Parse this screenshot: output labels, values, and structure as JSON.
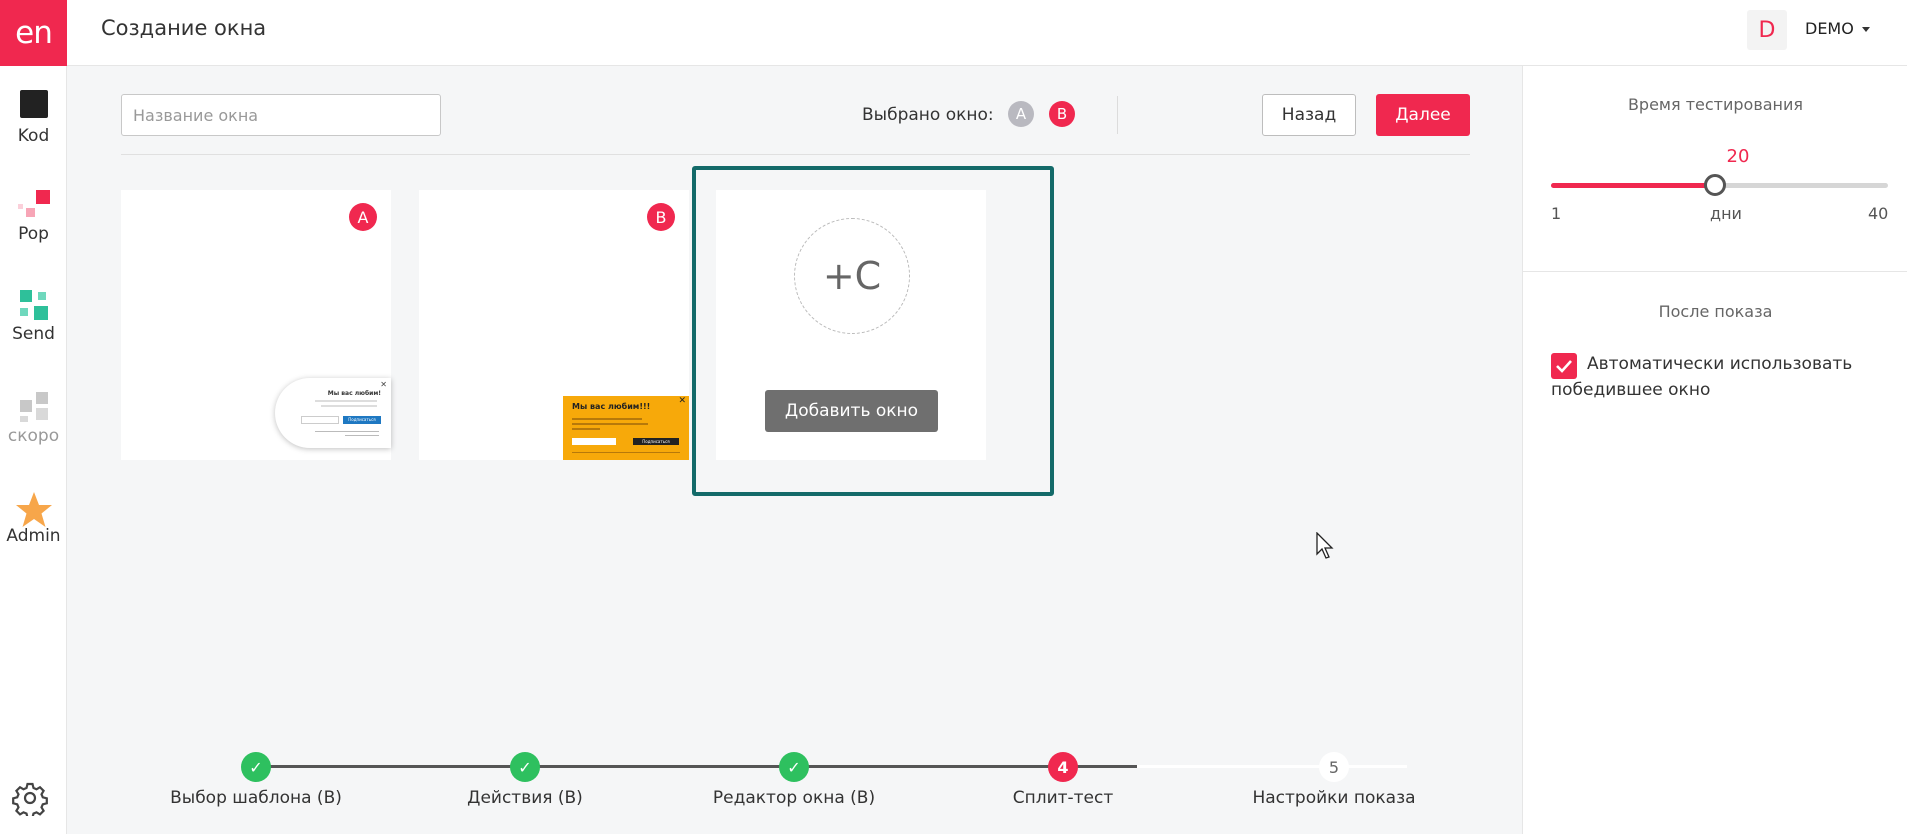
{
  "app": {
    "logo_text": "en",
    "page_title": "Создание окна",
    "accent_color": "#f0284f",
    "success_color": "#2ec05f",
    "frame_color": "#136a69"
  },
  "sidebar": {
    "items": [
      {
        "label": "Kod",
        "icon": "kod-square-icon"
      },
      {
        "label": "Pop",
        "icon": "pop-squares-icon"
      },
      {
        "label": "Send",
        "icon": "send-squares-icon"
      },
      {
        "label": "скоро",
        "icon": "soon-squares-icon"
      },
      {
        "label": "Admin",
        "icon": "star-icon"
      }
    ],
    "settings_icon": "gear-icon"
  },
  "user": {
    "avatar_letter": "D",
    "name": "DEMO"
  },
  "toolbar": {
    "name_placeholder": "Название окна",
    "name_value": "",
    "selected_label": "Выбрано окно:",
    "selected_a": "A",
    "selected_b": "B",
    "back_label": "Назад",
    "next_label": "Далее"
  },
  "variants": [
    {
      "badge": "A",
      "preview": {
        "title": "Мы вас любим!",
        "button": "Подписаться"
      }
    },
    {
      "badge": "B",
      "preview": {
        "title": "Мы вас любим!!!",
        "button": "Подписаться"
      }
    },
    {
      "placeholder": "+C",
      "add_button": "Добавить окно"
    }
  ],
  "steps": [
    {
      "label": "Выбор шаблона (B)",
      "status": "done",
      "mark": "✓"
    },
    {
      "label": "Действия (B)",
      "status": "done",
      "mark": "✓"
    },
    {
      "label": "Редактор окна (B)",
      "status": "done",
      "mark": "✓"
    },
    {
      "label": "Сплит-тест",
      "status": "active",
      "mark": "4"
    },
    {
      "label": "Настройки показа",
      "status": "todo",
      "mark": "5"
    }
  ],
  "testing": {
    "title": "Время тестирования",
    "value": "20",
    "value_num": 20,
    "min": "1",
    "max": "40",
    "min_num": 1,
    "max_num": 40,
    "unit": "дни"
  },
  "after_show": {
    "title": "После показа",
    "checkbox_checked": true,
    "checkbox_label": "Автоматически использовать победившее окно"
  }
}
